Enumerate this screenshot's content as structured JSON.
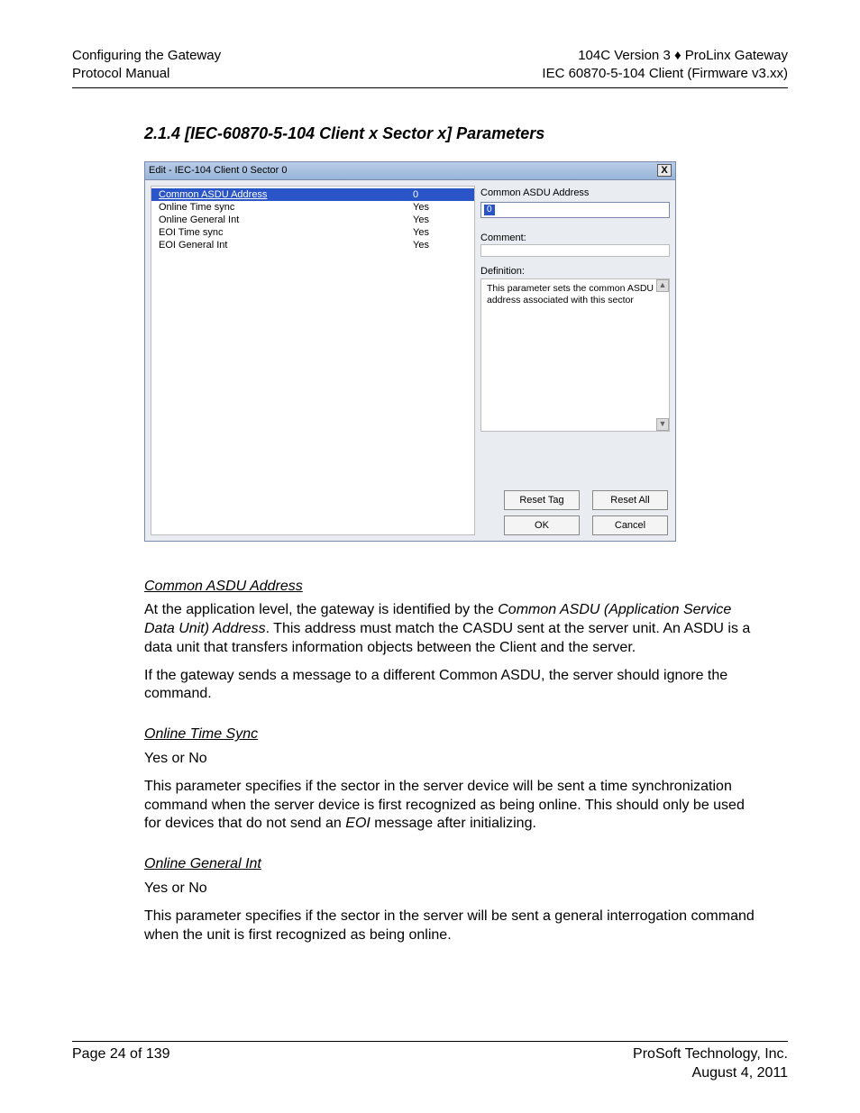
{
  "header": {
    "left1": "Configuring the  Gateway",
    "left2": "Protocol Manual",
    "right1": "104C Version 3 ♦ ProLinx Gateway",
    "right2": "IEC 60870-5-104 Client (Firmware v3.xx)"
  },
  "section_title": "2.1.4   [IEC-60870-5-104 Client x Sector x] Parameters",
  "dialog": {
    "title": "Edit - IEC-104 Client 0 Sector 0",
    "close": "X",
    "params": [
      {
        "name": "Common ASDU Address",
        "value": "0",
        "selected": true
      },
      {
        "name": "Online Time sync",
        "value": "Yes",
        "selected": false
      },
      {
        "name": "Online General Int",
        "value": "Yes",
        "selected": false
      },
      {
        "name": "EOI Time sync",
        "value": "Yes",
        "selected": false
      },
      {
        "name": "EOI General Int",
        "value": "Yes",
        "selected": false
      }
    ],
    "right": {
      "field_label": "Common ASDU Address",
      "field_value": "0",
      "comment_label": "Comment:",
      "definition_label": "Definition:",
      "definition_text": "This parameter sets the common ASDU address associated with this sector"
    },
    "buttons": {
      "reset_tag": "Reset Tag",
      "reset_all": "Reset All",
      "ok": "OK",
      "cancel": "Cancel"
    }
  },
  "body": {
    "h1": "Common ASDU Address",
    "p1a": "At the application level, the gateway is identified by the ",
    "p1b_ital": "Common ASDU (Application Service Data Unit) Address",
    "p1c": ". This address must match the CASDU sent at the server unit. An ASDU is a data unit that transfers information objects between the Client and the server.",
    "p2": "If the gateway sends a message to a different Common ASDU, the server should ignore the command.",
    "h2": "Online Time Sync",
    "p3": "Yes or No",
    "p4a": "This parameter specifies if the sector in the server device will be sent a time synchronization command when the server device is first recognized as being online. This should only be used for devices that do not send an ",
    "p4b_ital": "EOI",
    "p4c": " message after initializing.",
    "h3": "Online General Int",
    "p5": "Yes or No",
    "p6": "This parameter specifies if the sector in the server will be sent a general interrogation command when the unit is first recognized as being online."
  },
  "footer": {
    "left": "Page 24 of 139",
    "right1": "ProSoft Technology, Inc.",
    "right2": "August 4, 2011"
  }
}
